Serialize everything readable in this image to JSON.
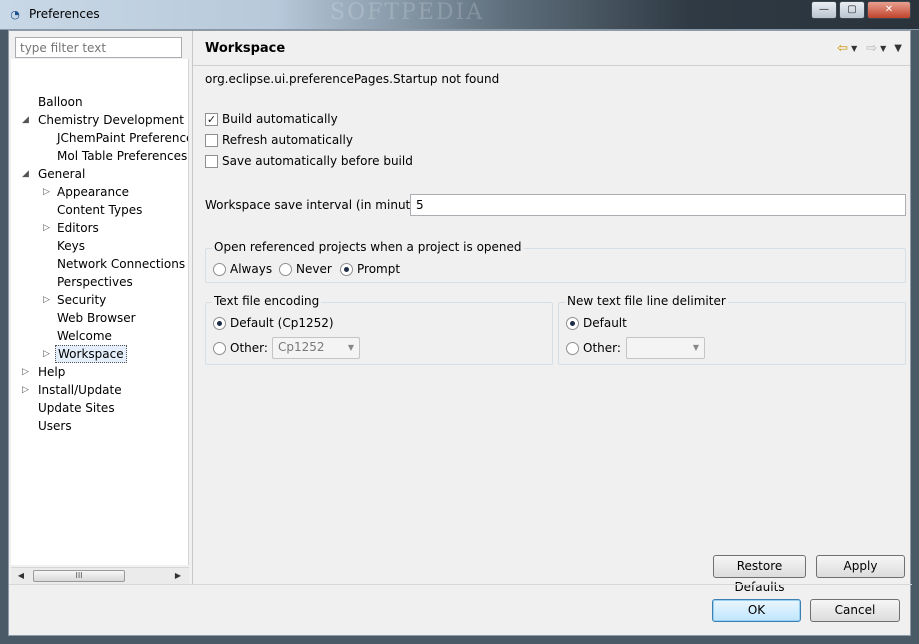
{
  "window": {
    "title": "Preferences",
    "watermark": "SOFTPEDIA",
    "minimize_glyph": "—",
    "maximize_glyph": "▢",
    "close_glyph": "✕"
  },
  "filter": {
    "placeholder": "type filter text",
    "value": ""
  },
  "tree": {
    "items": [
      {
        "label": "Balloon"
      },
      {
        "label": "Chemistry Development Ki"
      },
      {
        "label": "JChemPaint Preference"
      },
      {
        "label": "Mol Table Preferences"
      },
      {
        "label": "General"
      },
      {
        "label": "Appearance"
      },
      {
        "label": "Content Types"
      },
      {
        "label": "Editors"
      },
      {
        "label": "Keys"
      },
      {
        "label": "Network Connections"
      },
      {
        "label": "Perspectives"
      },
      {
        "label": "Security"
      },
      {
        "label": "Web Browser"
      },
      {
        "label": "Welcome"
      },
      {
        "label": "Workspace"
      },
      {
        "label": "Help"
      },
      {
        "label": "Install/Update"
      },
      {
        "label": "Update Sites"
      },
      {
        "label": "Users"
      }
    ],
    "expanded_glyph": "◢",
    "collapsed_glyph": "▷",
    "scroll_thumb_glyph": "III",
    "scroll_left_glyph": "◀",
    "scroll_right_glyph": "▶"
  },
  "page": {
    "title": "Workspace",
    "message": "org.eclipse.ui.preferencePages.Startup not found",
    "nav": {
      "back_glyph": "⇦",
      "forward_glyph": "⇨",
      "dropdown_glyph": "▼",
      "menu_glyph": "▼"
    },
    "checkboxes": [
      {
        "label": "Build automatically",
        "checked": true
      },
      {
        "label": "Refresh automatically",
        "checked": false
      },
      {
        "label": "Save automatically before build",
        "checked": false
      }
    ],
    "check_glyph": "✓",
    "interval": {
      "label": "Workspace save interval (in minutes):",
      "value": "5"
    },
    "open_projects": {
      "title": "Open referenced projects when a project is opened",
      "options": [
        "Always",
        "Never",
        "Prompt"
      ],
      "selected": "Prompt"
    },
    "encoding": {
      "title": "Text file encoding",
      "default_label": "Default (Cp1252)",
      "other_label": "Other:",
      "other_value": "Cp1252",
      "selected": "default"
    },
    "delimiter": {
      "title": "New text file line delimiter",
      "default_label": "Default",
      "other_label": "Other:",
      "other_value": "",
      "selected": "default"
    },
    "restore_defaults_label": "Restore Defaults",
    "apply_label": "Apply"
  },
  "dialog": {
    "ok_label": "OK",
    "cancel_label": "Cancel"
  }
}
